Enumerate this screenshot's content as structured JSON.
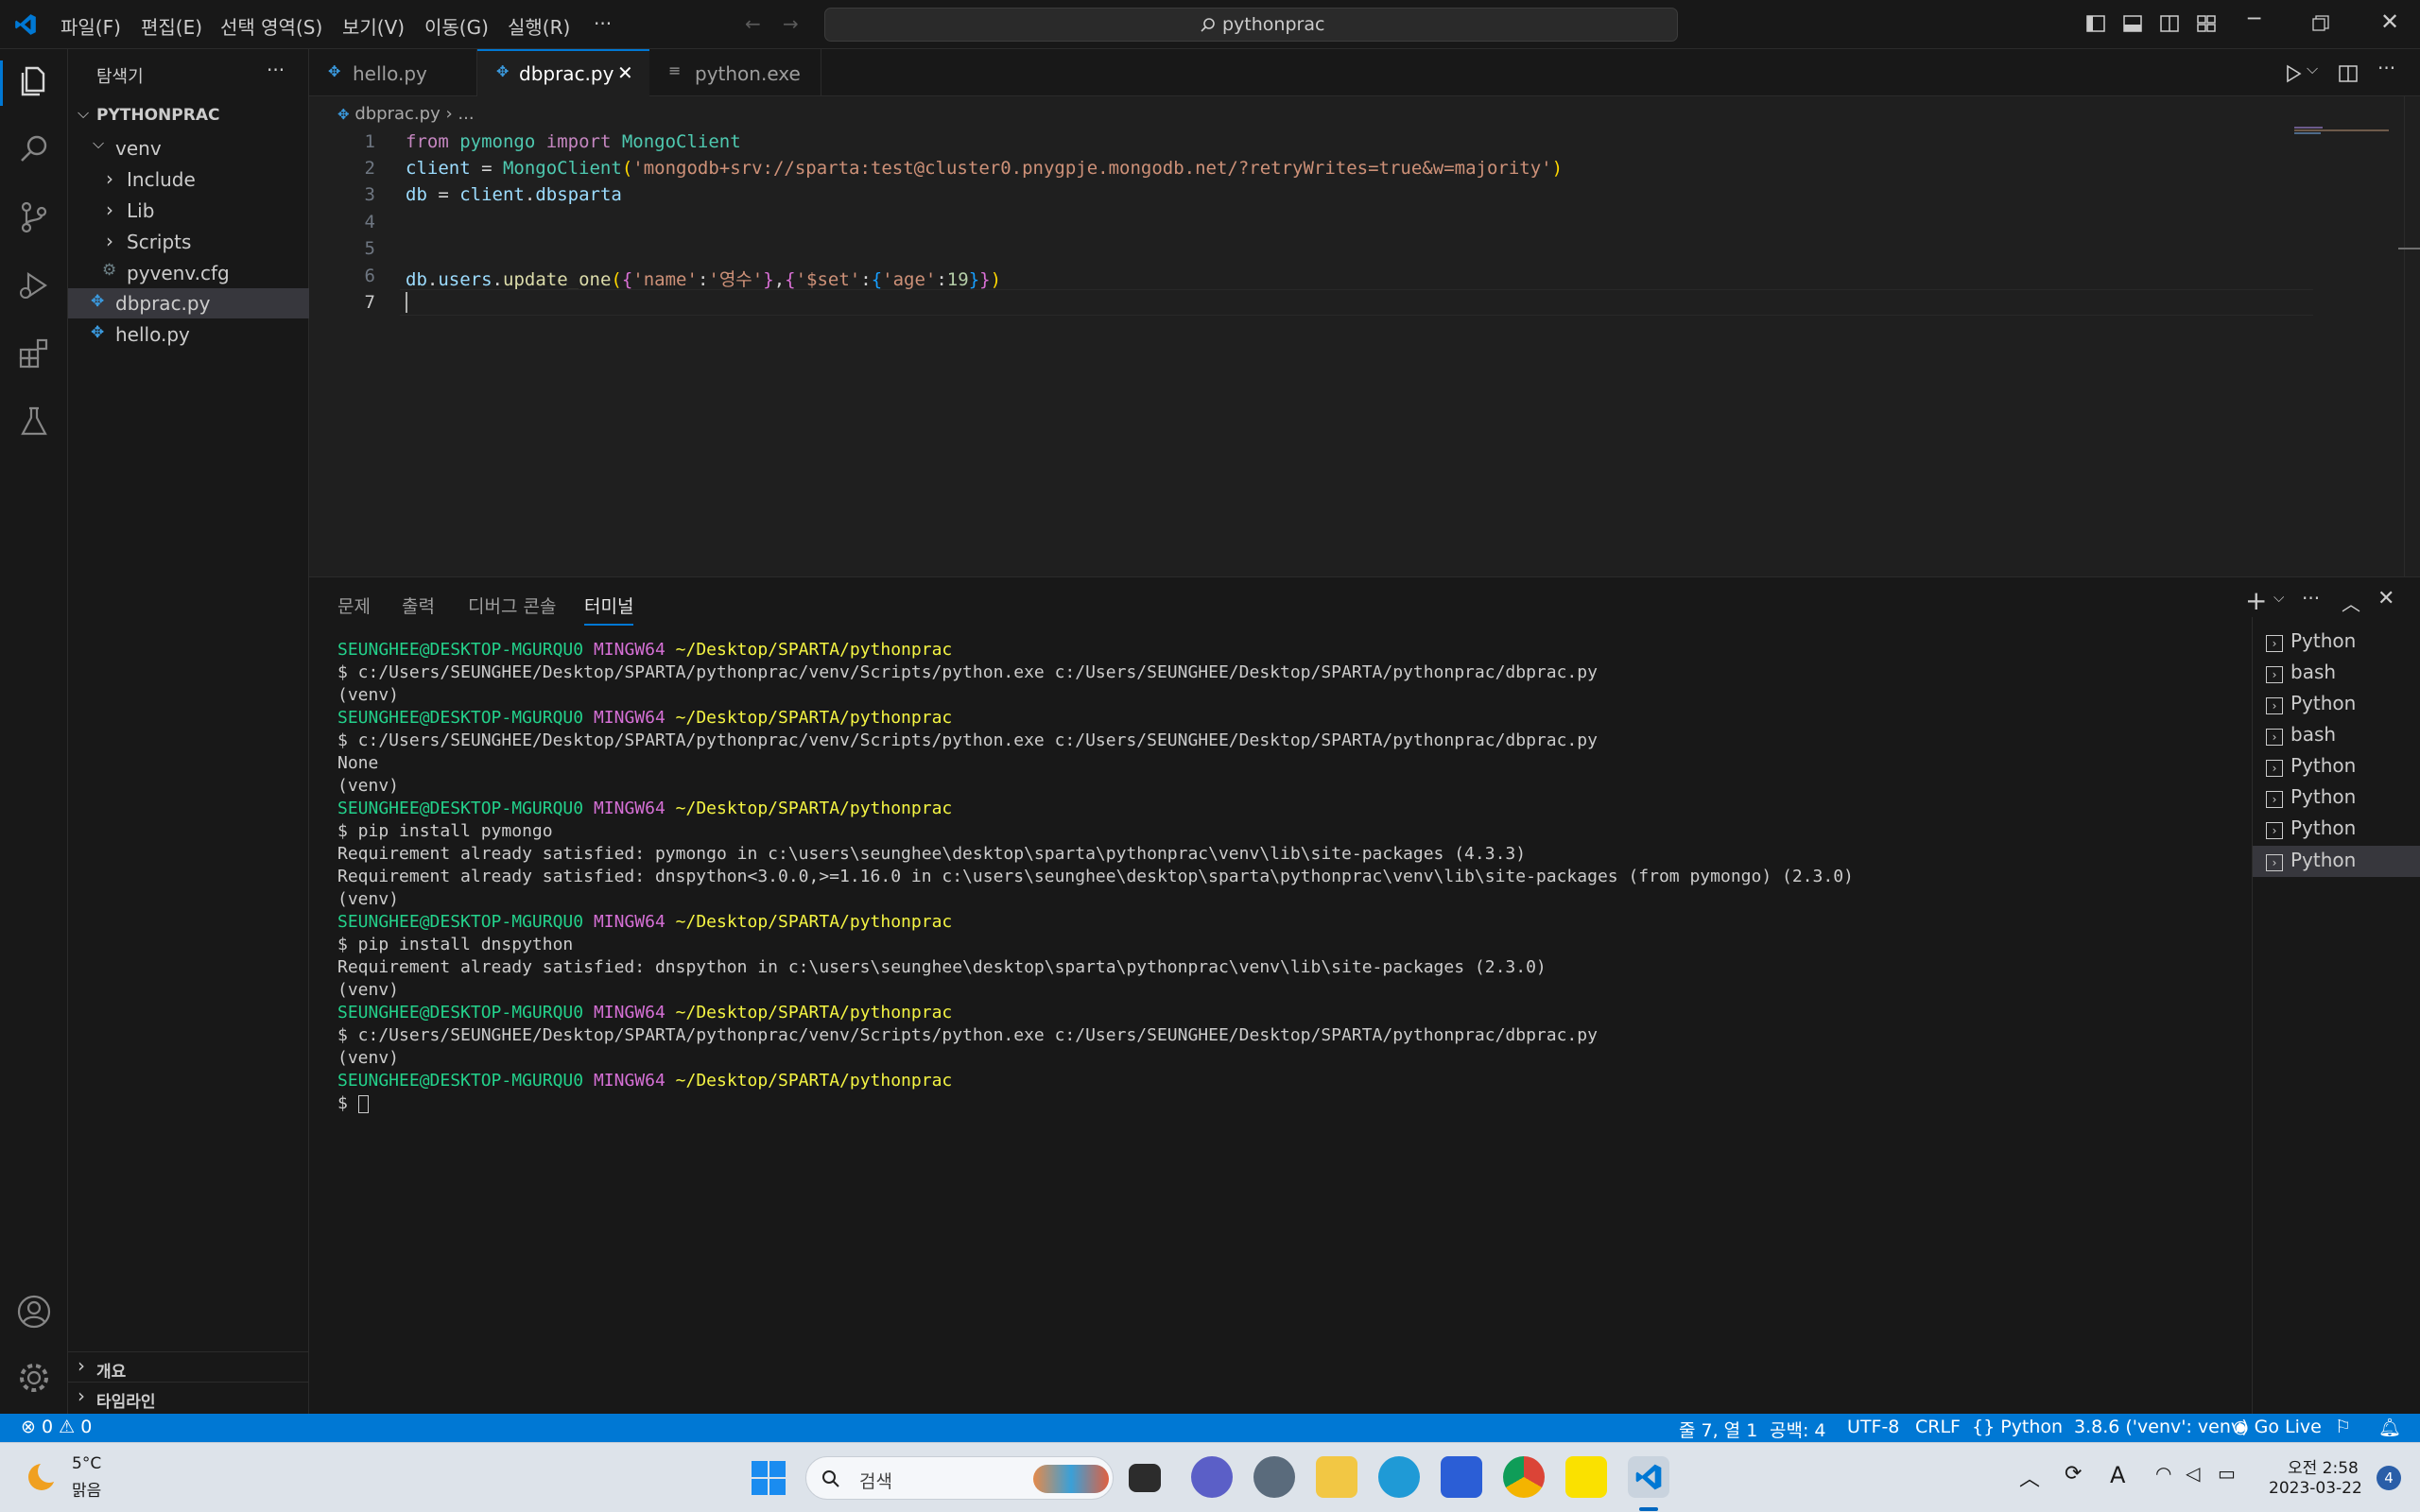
{
  "titlebar": {
    "menus": [
      "파일(F)",
      "편집(E)",
      "선택 영역(S)",
      "보기(V)",
      "이동(G)",
      "실행(R)",
      "···"
    ],
    "search": "pythonprac"
  },
  "sidebar": {
    "title": "탐색기",
    "more": "···",
    "root": "PYTHONPRAC",
    "items": [
      {
        "label": "venv"
      },
      {
        "label": "Include"
      },
      {
        "label": "Lib"
      },
      {
        "label": "Scripts"
      },
      {
        "label": "pyvenv.cfg"
      },
      {
        "label": "dbprac.py"
      },
      {
        "label": "hello.py"
      }
    ],
    "outline": "개요",
    "timeline": "타임라인"
  },
  "tabs": [
    {
      "label": "hello.py"
    },
    {
      "label": "dbprac.py",
      "close": "✕"
    },
    {
      "label": "python.exe"
    }
  ],
  "breadcrumb": {
    "file": "dbprac.py",
    "sep": "›",
    "rest": "..."
  },
  "editor": {
    "line_numbers": [
      "1",
      "2",
      "3",
      "4",
      "5",
      "6",
      "7"
    ],
    "line1": {
      "from": "from",
      "mod": "pymongo",
      "import": "import",
      "cls": "MongoClient"
    },
    "line2": {
      "var": "client",
      "eq": " = ",
      "cls": "MongoClient",
      "open": "(",
      "str": "'mongodb+srv://sparta:test@cluster0.pnygpje.mongodb.net/?retryWrites=true&w=majority'",
      "close": ")"
    },
    "line3": {
      "var": "db",
      "eq": " = ",
      "rest": "client",
      "dot": ".",
      "attr": "dbsparta"
    },
    "line6": {
      "a": "db",
      "b": ".",
      "c": "users",
      "d": ".",
      "e": "update_one",
      "f": "(",
      "g": "{",
      "h": "'name'",
      "i": ":",
      "j": "'영수'",
      "k": "}",
      "l": ",",
      "m": "{",
      "n": "'$set'",
      "o": ":",
      "p": "{",
      "q": "'age'",
      "r": ":",
      "s": "19",
      "t": "}",
      "u": "}",
      "v": ")"
    }
  },
  "panel": {
    "tabs": [
      "문제",
      "출력",
      "디버그 콘솔",
      "터미널"
    ],
    "prompt_user": "SEUNGHEE@DESKTOP-MGURQU0",
    "prompt_sys": "MINGW64",
    "prompt_path": "~/Desktop/SPARTA/pythonprac",
    "lines": {
      "cmd_run": "$ c:/Users/SEUNGHEE/Desktop/SPARTA/pythonprac/venv/Scripts/python.exe c:/Users/SEUNGHEE/Desktop/SPARTA/pythonprac/dbprac.py",
      "venv": "(venv)",
      "none": "None",
      "pip_pymongo": "$ pip install pymongo",
      "req1": "Requirement already satisfied: pymongo in c:\\users\\seunghee\\desktop\\sparta\\pythonprac\\venv\\lib\\site-packages (4.3.3)",
      "req2": "Requirement already satisfied: dnspython<3.0.0,>=1.16.0 in c:\\users\\seunghee\\desktop\\sparta\\pythonprac\\venv\\lib\\site-packages (from pymongo) (2.3.0)",
      "pip_dns": "$ pip install dnspython",
      "req3": "Requirement already satisfied: dnspython in c:\\users\\seunghee\\desktop\\sparta\\pythonprac\\venv\\lib\\site-packages (2.3.0)",
      "dollar": "$ "
    },
    "terminals": [
      "Python",
      "bash",
      "Python",
      "bash",
      "Python",
      "Python",
      "Python",
      "Python"
    ]
  },
  "status": {
    "errors": "0",
    "warnings": "0",
    "position": "줄 7, 열 1",
    "spaces": "공백: 4",
    "encoding": "UTF-8",
    "eol": "CRLF",
    "language": "Python",
    "interpreter": "3.8.6 ('venv': venv)",
    "golive": "Go Live"
  },
  "taskbar": {
    "weather_temp": "5°C",
    "weather_desc": "맑음",
    "search": "검색",
    "time": "오전 2:58",
    "date": "2023-03-22",
    "notif": "4"
  },
  "colors": {
    "accent": "#0078d4",
    "editor_bg": "#1f1f1f",
    "panel_bg": "#181818"
  }
}
